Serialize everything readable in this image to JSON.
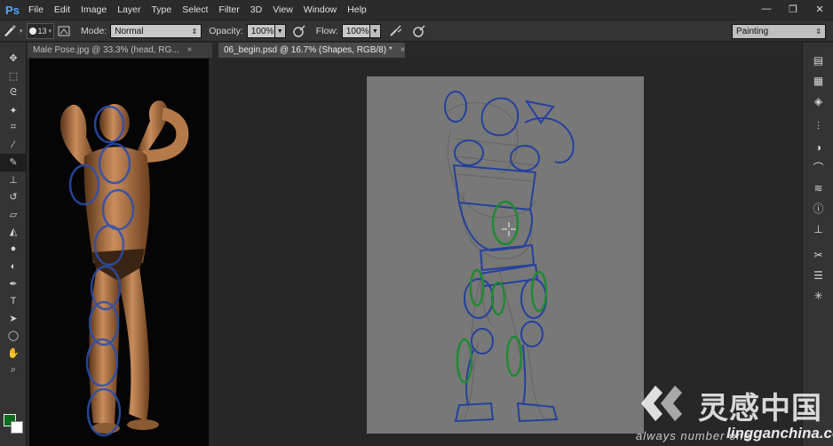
{
  "app": {
    "logo": "Ps"
  },
  "menu": [
    "File",
    "Edit",
    "Image",
    "Layer",
    "Type",
    "Select",
    "Filter",
    "3D",
    "View",
    "Window",
    "Help"
  ],
  "window_controls": [
    "—",
    "❐",
    "✕"
  ],
  "options": {
    "brush_size": "13",
    "mode_label": "Mode:",
    "mode_value": "Normal",
    "opacity_label": "Opacity:",
    "opacity_value": "100%",
    "flow_label": "Flow:",
    "flow_value": "100%",
    "workspace": "Painting"
  },
  "documents": [
    {
      "tab": "Male Pose.jpg @ 33.3% (head, RG...",
      "close": "×"
    },
    {
      "tab": "06_begin.psd @ 16.7% (Shapes, RGB/8) *",
      "close": "×"
    }
  ],
  "tools": [
    "move-icon",
    "marquee-icon",
    "lasso-icon",
    "magic-wand-icon",
    "crop-icon",
    "eyedropper-icon",
    "brush-icon",
    "clone-stamp-icon",
    "history-brush-icon",
    "eraser-icon",
    "paint-bucket-icon",
    "blur-icon",
    "dodge-icon",
    "pen-icon",
    "type-icon",
    "path-select-icon",
    "ellipse-icon",
    "hand-icon",
    "zoom-icon"
  ],
  "right_panel": [
    "history-icon",
    "color-swatches-icon",
    "layers-icon",
    "brush-presets-icon",
    "adjustments-icon",
    "paths-icon",
    "channels-icon",
    "info-icon",
    "clone-source-icon",
    "tool-presets-icon",
    "character-icon",
    "properties-icon"
  ],
  "colors": {
    "foreground": "#0c6e1c",
    "background": "#ffffff",
    "accent": "#4fa7ff"
  },
  "watermark": {
    "brand": "灵感中国",
    "slogan": "always number one",
    "domain": "lingganchina.com"
  }
}
